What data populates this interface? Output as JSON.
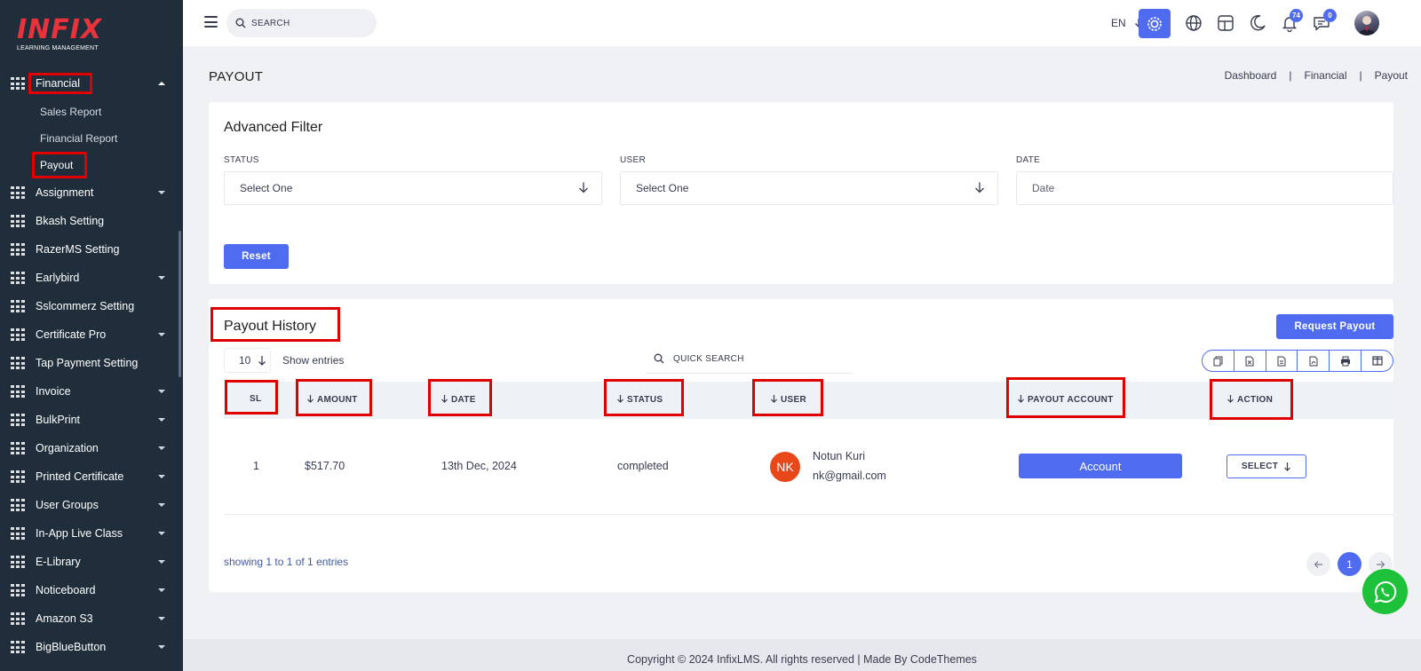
{
  "brand": {
    "logo_text": "INFIX",
    "logo_sub": "LEARNING MANAGEMENT"
  },
  "sidebar": {
    "financial": {
      "label": "Financial",
      "expanded": true,
      "children": [
        {
          "label": "Sales Report"
        },
        {
          "label": "Financial Report"
        },
        {
          "label": "Payout",
          "active": true
        }
      ]
    },
    "items": [
      {
        "label": "Assignment",
        "has_caret": true
      },
      {
        "label": "Bkash Setting",
        "has_caret": false
      },
      {
        "label": "RazerMS Setting",
        "has_caret": false
      },
      {
        "label": "Earlybird",
        "has_caret": true
      },
      {
        "label": "Sslcommerz Setting",
        "has_caret": false
      },
      {
        "label": "Certificate Pro",
        "has_caret": true
      },
      {
        "label": "Tap Payment Setting",
        "has_caret": false
      },
      {
        "label": "Invoice",
        "has_caret": true
      },
      {
        "label": "BulkPrint",
        "has_caret": true
      },
      {
        "label": "Organization",
        "has_caret": true
      },
      {
        "label": "Printed Certificate",
        "has_caret": true
      },
      {
        "label": "User Groups",
        "has_caret": true
      },
      {
        "label": "In-App Live Class",
        "has_caret": true
      },
      {
        "label": "E-Library",
        "has_caret": true
      },
      {
        "label": "Noticeboard",
        "has_caret": true
      },
      {
        "label": "Amazon S3",
        "has_caret": true
      },
      {
        "label": "BigBlueButton",
        "has_caret": true
      }
    ]
  },
  "topbar": {
    "search_placeholder": "SEARCH",
    "language": "EN",
    "notifications_count": "74",
    "messages_count": "0",
    "icons": [
      "menu-icon",
      "search-icon",
      "settings-gear-icon",
      "globe-icon",
      "layout-icon",
      "moon-icon",
      "bell-icon",
      "chat-icon",
      "avatar"
    ]
  },
  "page": {
    "title": "PAYOUT",
    "breadcrumb": [
      "Dashboard",
      "Financial",
      "Payout"
    ]
  },
  "filter": {
    "title": "Advanced Filter",
    "status_label": "STATUS",
    "status_value": "Select One",
    "user_label": "USER",
    "user_value": "Select One",
    "date_label": "DATE",
    "date_placeholder": "Date",
    "reset_label": "Reset"
  },
  "history": {
    "title": "Payout History",
    "request_button": "Request Payout",
    "entries_value": "10",
    "show_entries": "Show entries",
    "quick_search": "QUICK SEARCH",
    "columns": [
      "SL",
      "AMOUNT",
      "DATE",
      "STATUS",
      "USER",
      "PAYOUT ACCOUNT",
      "ACTION"
    ],
    "rows": [
      {
        "sl": "1",
        "amount": "$517.70",
        "date": "13th Dec, 2024",
        "status": "completed",
        "initials": "NK",
        "user_name": "Notun Kuri",
        "user_email": "nk@gmail.com",
        "account_button": "Account",
        "action": "SELECT"
      }
    ],
    "showing": "showing 1 to 1 of 1 entries",
    "current_page": "1"
  },
  "footer": {
    "text": "Copyright © 2024 InfixLMS. All rights reserved | Made By CodeThemes"
  },
  "colors": {
    "primary": "#4f6cf0",
    "sidebar": "#202e3b",
    "highlight": "#e00000",
    "logo": "#e8333c",
    "whatsapp": "#1ec13a",
    "avatar_nk": "#e84719"
  }
}
